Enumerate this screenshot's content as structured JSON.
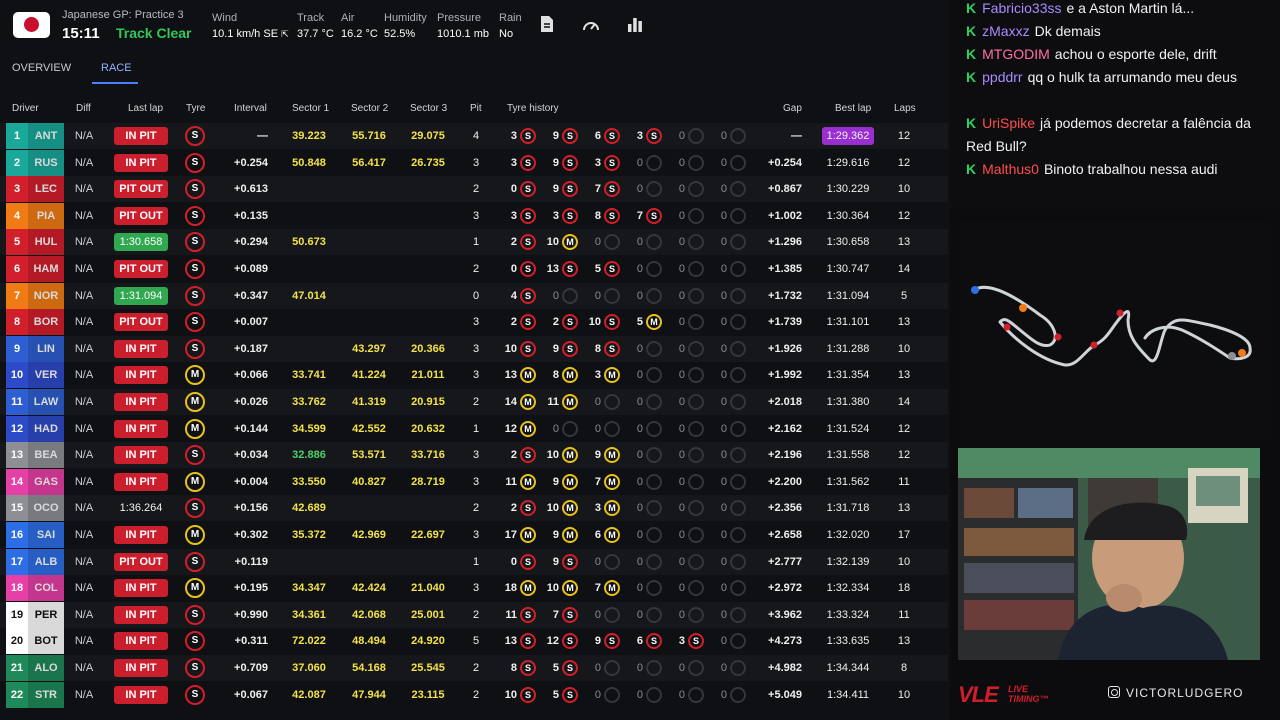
{
  "header": {
    "session": "Japanese GP: Practice 3",
    "clock": "15:11",
    "track_status": "Track Clear",
    "weather": [
      {
        "label": "Wind",
        "value": "10.1 km/h SE"
      },
      {
        "label": "Track",
        "value": "37.7 °C"
      },
      {
        "label": "Air",
        "value": "16.2 °C"
      },
      {
        "label": "Humidity",
        "value": "52.5%"
      },
      {
        "label": "Pressure",
        "value": "1010.1 mb"
      },
      {
        "label": "Rain",
        "value": "No"
      }
    ]
  },
  "tabs": [
    "OVERVIEW",
    "RACE"
  ],
  "columns": [
    "Driver",
    "Diff",
    "Last lap",
    "Tyre",
    "Interval",
    "Sector 1",
    "Sector 2",
    "Sector 3",
    "Pit",
    "Tyre history",
    "Gap",
    "Best lap",
    "Laps"
  ],
  "rows": [
    {
      "pos": "1",
      "code": "ANT",
      "team": "#19a89a",
      "diff": "N/A",
      "status": "IN PIT",
      "st": "red",
      "tyre": "S",
      "interval": "—",
      "s1": "39.223",
      "s1g": false,
      "s2": "55.716",
      "s3": "29.075",
      "pit": "4",
      "hist": [
        [
          "3",
          "S"
        ],
        [
          "9",
          "S"
        ],
        [
          "6",
          "S"
        ],
        [
          "3",
          "S"
        ],
        [
          "0",
          ""
        ],
        [
          "0",
          ""
        ]
      ],
      "gap": "—",
      "best": "1:29.362",
      "purple": true,
      "laps": "12"
    },
    {
      "pos": "2",
      "code": "RUS",
      "team": "#19a89a",
      "diff": "N/A",
      "status": "IN PIT",
      "st": "red",
      "tyre": "S",
      "interval": "+0.254",
      "s1": "50.848",
      "s1g": false,
      "s2": "56.417",
      "s3": "26.735",
      "pit": "3",
      "hist": [
        [
          "3",
          "S"
        ],
        [
          "9",
          "S"
        ],
        [
          "3",
          "S"
        ],
        [
          "0",
          ""
        ],
        [
          "0",
          ""
        ],
        [
          "0",
          ""
        ]
      ],
      "gap": "+0.254",
      "best": "1:29.616",
      "purple": false,
      "laps": "12"
    },
    {
      "pos": "3",
      "code": "LEC",
      "team": "#d21f2c",
      "diff": "N/A",
      "status": "PIT OUT",
      "st": "red",
      "tyre": "S",
      "interval": "+0.613",
      "s1": "",
      "s1g": false,
      "s2": "",
      "s3": "",
      "pit": "2",
      "hist": [
        [
          "0",
          "S"
        ],
        [
          "9",
          "S"
        ],
        [
          "7",
          "S"
        ],
        [
          "0",
          ""
        ],
        [
          "0",
          ""
        ],
        [
          "0",
          ""
        ]
      ],
      "gap": "+0.867",
      "best": "1:30.229",
      "purple": false,
      "laps": "10"
    },
    {
      "pos": "4",
      "code": "PIA",
      "team": "#f07b14",
      "diff": "N/A",
      "status": "PIT OUT",
      "st": "red",
      "tyre": "S",
      "interval": "+0.135",
      "s1": "",
      "s1g": false,
      "s2": "",
      "s3": "",
      "pit": "3",
      "hist": [
        [
          "3",
          "S"
        ],
        [
          "3",
          "S"
        ],
        [
          "8",
          "S"
        ],
        [
          "7",
          "S"
        ],
        [
          "0",
          ""
        ],
        [
          "0",
          ""
        ]
      ],
      "gap": "+1.002",
      "best": "1:30.364",
      "purple": false,
      "laps": "12"
    },
    {
      "pos": "5",
      "code": "HUL",
      "team": "#d21f2c",
      "diff": "N/A",
      "status": "1:30.658",
      "st": "grn",
      "tyre": "S",
      "interval": "+0.294",
      "s1": "50.673",
      "s1g": false,
      "s2": "",
      "s3": "",
      "pit": "1",
      "hist": [
        [
          "2",
          "S"
        ],
        [
          "10",
          "M"
        ],
        [
          "0",
          ""
        ],
        [
          "0",
          ""
        ],
        [
          "0",
          ""
        ],
        [
          "0",
          ""
        ]
      ],
      "gap": "+1.296",
      "best": "1:30.658",
      "purple": false,
      "laps": "13"
    },
    {
      "pos": "6",
      "code": "HAM",
      "team": "#d21f2c",
      "diff": "N/A",
      "status": "PIT OUT",
      "st": "red",
      "tyre": "S",
      "interval": "+0.089",
      "s1": "",
      "s1g": false,
      "s2": "",
      "s3": "",
      "pit": "2",
      "hist": [
        [
          "0",
          "S"
        ],
        [
          "13",
          "S"
        ],
        [
          "5",
          "S"
        ],
        [
          "0",
          ""
        ],
        [
          "0",
          ""
        ],
        [
          "0",
          ""
        ]
      ],
      "gap": "+1.385",
      "best": "1:30.747",
      "purple": false,
      "laps": "14"
    },
    {
      "pos": "7",
      "code": "NOR",
      "team": "#f07b14",
      "diff": "N/A",
      "status": "1:31.094",
      "st": "grn",
      "tyre": "S",
      "interval": "+0.347",
      "s1": "47.014",
      "s1g": false,
      "s2": "",
      "s3": "",
      "pit": "0",
      "hist": [
        [
          "4",
          "S"
        ],
        [
          "0",
          ""
        ],
        [
          "0",
          ""
        ],
        [
          "0",
          ""
        ],
        [
          "0",
          ""
        ],
        [
          "0",
          ""
        ]
      ],
      "gap": "+1.732",
      "best": "1:31.094",
      "purple": false,
      "laps": "5"
    },
    {
      "pos": "8",
      "code": "BOR",
      "team": "#d21f2c",
      "diff": "N/A",
      "status": "PIT OUT",
      "st": "red",
      "tyre": "S",
      "interval": "+0.007",
      "s1": "",
      "s1g": false,
      "s2": "",
      "s3": "",
      "pit": "3",
      "hist": [
        [
          "2",
          "S"
        ],
        [
          "2",
          "S"
        ],
        [
          "10",
          "S"
        ],
        [
          "5",
          "M"
        ],
        [
          "0",
          ""
        ],
        [
          "0",
          ""
        ]
      ],
      "gap": "+1.739",
      "best": "1:31.101",
      "purple": false,
      "laps": "13"
    },
    {
      "pos": "9",
      "code": "LIN",
      "team": "#2d5fd3",
      "diff": "N/A",
      "status": "IN PIT",
      "st": "red",
      "tyre": "S",
      "interval": "+0.187",
      "s1": "",
      "s1g": false,
      "s2": "43.297",
      "s3": "20.366",
      "pit": "3",
      "hist": [
        [
          "10",
          "S"
        ],
        [
          "9",
          "S"
        ],
        [
          "8",
          "S"
        ],
        [
          "0",
          ""
        ],
        [
          "0",
          ""
        ],
        [
          "0",
          ""
        ]
      ],
      "gap": "+1.926",
      "best": "1:31.288",
      "purple": false,
      "laps": "10"
    },
    {
      "pos": "10",
      "code": "VER",
      "team": "#2d4ac9",
      "diff": "N/A",
      "status": "IN PIT",
      "st": "red",
      "tyre": "M",
      "interval": "+0.066",
      "s1": "33.741",
      "s1g": false,
      "s2": "41.224",
      "s3": "21.011",
      "pit": "3",
      "hist": [
        [
          "13",
          "M"
        ],
        [
          "8",
          "M"
        ],
        [
          "3",
          "M"
        ],
        [
          "0",
          ""
        ],
        [
          "0",
          ""
        ],
        [
          "0",
          ""
        ]
      ],
      "gap": "+1.992",
      "best": "1:31.354",
      "purple": false,
      "laps": "13"
    },
    {
      "pos": "11",
      "code": "LAW",
      "team": "#2d5fd3",
      "diff": "N/A",
      "status": "IN PIT",
      "st": "red",
      "tyre": "M",
      "interval": "+0.026",
      "s1": "33.762",
      "s1g": false,
      "s2": "41.319",
      "s3": "20.915",
      "pit": "2",
      "hist": [
        [
          "14",
          "M"
        ],
        [
          "11",
          "M"
        ],
        [
          "0",
          ""
        ],
        [
          "0",
          ""
        ],
        [
          "0",
          ""
        ],
        [
          "0",
          ""
        ]
      ],
      "gap": "+2.018",
      "best": "1:31.380",
      "purple": false,
      "laps": "14"
    },
    {
      "pos": "12",
      "code": "HAD",
      "team": "#2d4ac9",
      "diff": "N/A",
      "status": "IN PIT",
      "st": "red",
      "tyre": "M",
      "interval": "+0.144",
      "s1": "34.599",
      "s1g": false,
      "s2": "42.552",
      "s3": "20.632",
      "pit": "1",
      "hist": [
        [
          "12",
          "M"
        ],
        [
          "0",
          ""
        ],
        [
          "0",
          ""
        ],
        [
          "0",
          ""
        ],
        [
          "0",
          ""
        ],
        [
          "0",
          ""
        ]
      ],
      "gap": "+2.162",
      "best": "1:31.524",
      "purple": false,
      "laps": "12"
    },
    {
      "pos": "13",
      "code": "BEA",
      "team": "#8d8f95",
      "diff": "N/A",
      "status": "IN PIT",
      "st": "red",
      "tyre": "S",
      "interval": "+0.034",
      "s1": "32.886",
      "s1g": true,
      "s2": "53.571",
      "s3": "33.716",
      "pit": "3",
      "hist": [
        [
          "2",
          "S"
        ],
        [
          "10",
          "M"
        ],
        [
          "9",
          "M"
        ],
        [
          "0",
          ""
        ],
        [
          "0",
          ""
        ],
        [
          "0",
          ""
        ]
      ],
      "gap": "+2.196",
      "best": "1:31.558",
      "purple": false,
      "laps": "12"
    },
    {
      "pos": "14",
      "code": "GAS",
      "team": "#e63fa6",
      "diff": "N/A",
      "status": "IN PIT",
      "st": "red",
      "tyre": "M",
      "interval": "+0.004",
      "s1": "33.550",
      "s1g": false,
      "s2": "40.827",
      "s3": "28.719",
      "pit": "3",
      "hist": [
        [
          "11",
          "M"
        ],
        [
          "9",
          "M"
        ],
        [
          "7",
          "M"
        ],
        [
          "0",
          ""
        ],
        [
          "0",
          ""
        ],
        [
          "0",
          ""
        ]
      ],
      "gap": "+2.200",
      "best": "1:31.562",
      "purple": false,
      "laps": "11"
    },
    {
      "pos": "15",
      "code": "OCO",
      "team": "#8d8f95",
      "diff": "N/A",
      "status": "1:36.264",
      "st": "plain",
      "tyre": "S",
      "interval": "+0.156",
      "s1": "42.689",
      "s1g": false,
      "s2": "",
      "s3": "",
      "pit": "2",
      "hist": [
        [
          "2",
          "S"
        ],
        [
          "10",
          "M"
        ],
        [
          "3",
          "M"
        ],
        [
          "0",
          ""
        ],
        [
          "0",
          ""
        ],
        [
          "0",
          ""
        ]
      ],
      "gap": "+2.356",
      "best": "1:31.718",
      "purple": false,
      "laps": "13"
    },
    {
      "pos": "16",
      "code": "SAI",
      "team": "#2d6ee6",
      "diff": "N/A",
      "status": "IN PIT",
      "st": "red",
      "tyre": "M",
      "interval": "+0.302",
      "s1": "35.372",
      "s1g": false,
      "s2": "42.969",
      "s3": "22.697",
      "pit": "3",
      "hist": [
        [
          "17",
          "M"
        ],
        [
          "9",
          "M"
        ],
        [
          "6",
          "M"
        ],
        [
          "0",
          ""
        ],
        [
          "0",
          ""
        ],
        [
          "0",
          ""
        ]
      ],
      "gap": "+2.658",
      "best": "1:32.020",
      "purple": false,
      "laps": "17"
    },
    {
      "pos": "17",
      "code": "ALB",
      "team": "#2d6ee6",
      "diff": "N/A",
      "status": "PIT OUT",
      "st": "red",
      "tyre": "S",
      "interval": "+0.119",
      "s1": "",
      "s1g": false,
      "s2": "",
      "s3": "",
      "pit": "1",
      "hist": [
        [
          "0",
          "S"
        ],
        [
          "9",
          "S"
        ],
        [
          "0",
          ""
        ],
        [
          "0",
          ""
        ],
        [
          "0",
          ""
        ],
        [
          "0",
          ""
        ]
      ],
      "gap": "+2.777",
      "best": "1:32.139",
      "purple": false,
      "laps": "10"
    },
    {
      "pos": "18",
      "code": "COL",
      "team": "#e63fa6",
      "diff": "N/A",
      "status": "IN PIT",
      "st": "red",
      "tyre": "M",
      "interval": "+0.195",
      "s1": "34.347",
      "s1g": false,
      "s2": "42.424",
      "s3": "21.040",
      "pit": "3",
      "hist": [
        [
          "18",
          "M"
        ],
        [
          "10",
          "M"
        ],
        [
          "7",
          "M"
        ],
        [
          "0",
          ""
        ],
        [
          "0",
          ""
        ],
        [
          "0",
          ""
        ]
      ],
      "gap": "+2.972",
      "best": "1:32.334",
      "purple": false,
      "laps": "18"
    },
    {
      "pos": "19",
      "code": "PER",
      "team": "#ffffff",
      "diff": "N/A",
      "status": "IN PIT",
      "st": "red",
      "tyre": "S",
      "interval": "+0.990",
      "s1": "34.361",
      "s1g": false,
      "s2": "42.068",
      "s3": "25.001",
      "pit": "2",
      "hist": [
        [
          "11",
          "S"
        ],
        [
          "7",
          "S"
        ],
        [
          "0",
          ""
        ],
        [
          "0",
          ""
        ],
        [
          "0",
          ""
        ],
        [
          "0",
          ""
        ]
      ],
      "gap": "+3.962",
      "best": "1:33.324",
      "purple": false,
      "laps": "11"
    },
    {
      "pos": "20",
      "code": "BOT",
      "team": "#ffffff",
      "diff": "N/A",
      "status": "IN PIT",
      "st": "red",
      "tyre": "S",
      "interval": "+0.311",
      "s1": "72.022",
      "s1g": false,
      "s2": "48.494",
      "s3": "24.920",
      "pit": "5",
      "hist": [
        [
          "13",
          "S"
        ],
        [
          "12",
          "S"
        ],
        [
          "9",
          "S"
        ],
        [
          "6",
          "S"
        ],
        [
          "3",
          "S"
        ],
        [
          "0",
          ""
        ]
      ],
      "gap": "+4.273",
      "best": "1:33.635",
      "purple": false,
      "laps": "13"
    },
    {
      "pos": "21",
      "code": "ALO",
      "team": "#1e8a5a",
      "diff": "N/A",
      "status": "IN PIT",
      "st": "red",
      "tyre": "S",
      "interval": "+0.709",
      "s1": "37.060",
      "s1g": false,
      "s2": "54.168",
      "s3": "25.545",
      "pit": "2",
      "hist": [
        [
          "8",
          "S"
        ],
        [
          "5",
          "S"
        ],
        [
          "0",
          ""
        ],
        [
          "0",
          ""
        ],
        [
          "0",
          ""
        ],
        [
          "0",
          ""
        ]
      ],
      "gap": "+4.982",
      "best": "1:34.344",
      "purple": false,
      "laps": "8"
    },
    {
      "pos": "22",
      "code": "STR",
      "team": "#1e8a5a",
      "diff": "N/A",
      "status": "IN PIT",
      "st": "red",
      "tyre": "S",
      "interval": "+0.067",
      "s1": "42.087",
      "s1g": false,
      "s2": "47.944",
      "s3": "23.115",
      "pit": "2",
      "hist": [
        [
          "10",
          "S"
        ],
        [
          "5",
          "S"
        ],
        [
          "0",
          ""
        ],
        [
          "0",
          ""
        ],
        [
          "0",
          ""
        ],
        [
          "0",
          ""
        ]
      ],
      "gap": "+5.049",
      "best": "1:34.411",
      "purple": false,
      "laps": "10"
    }
  ],
  "chat": [
    {
      "user": "Fabricio33ss",
      "color": "#a98bff",
      "text": "e a Aston Martin lá..."
    },
    {
      "user": "zMaxxz",
      "color": "#a98bff",
      "text": "Dk demais"
    },
    {
      "user": "MTGODIM",
      "color": "#ff6fa8",
      "text": "achou o esporte dele, drift"
    },
    {
      "user": "ppddrr",
      "color": "#a98bff",
      "text": "qq o hulk ta arrumando meu deus"
    },
    {
      "user": "UriSpike",
      "color": "#ff4d4d",
      "text": "já podemos decretar a falência da Red Bull?"
    },
    {
      "user": "Malthus0",
      "color": "#ff4d4d",
      "text": "Binoto trabalhou nessa audi"
    }
  ],
  "chat_badge": "K",
  "branding": {
    "logo": "VLE",
    "sub1": "LIVE",
    "sub2": "TIMING™",
    "instagram": "VICTORLUDGERO"
  },
  "icons": {
    "doc": "document-icon",
    "gauge": "gauge-icon",
    "chart": "bar-chart-icon"
  }
}
